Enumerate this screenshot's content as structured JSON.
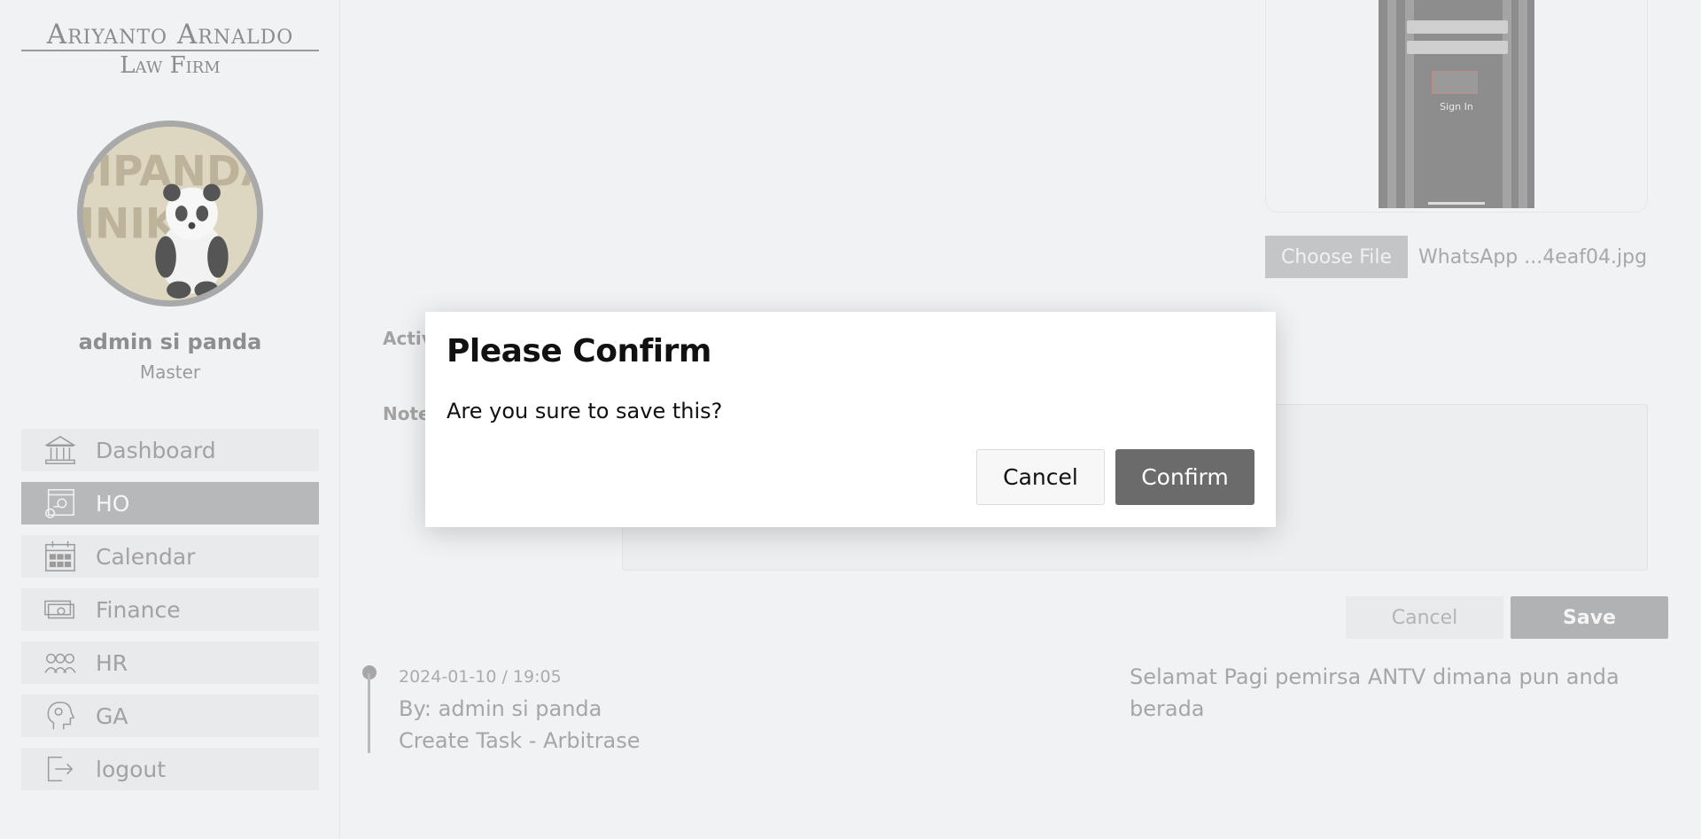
{
  "brand": {
    "name": "Ariyanto Arnaldo",
    "subtitle": "Law Firm"
  },
  "avatar": {
    "text_line1": "SIPANDA",
    "text_line2": "INIK"
  },
  "user": {
    "name": "admin si panda",
    "role": "Master"
  },
  "sidebar": {
    "items": [
      {
        "label": "Dashboard",
        "icon": "bank-icon",
        "active": false
      },
      {
        "label": "HO",
        "icon": "office-gear-icon",
        "active": true
      },
      {
        "label": "Calendar",
        "icon": "calendar-icon",
        "active": false
      },
      {
        "label": "Finance",
        "icon": "money-icon",
        "active": false
      },
      {
        "label": "HR",
        "icon": "people-icon",
        "active": false
      },
      {
        "label": "GA",
        "icon": "head-gear-icon",
        "active": false
      },
      {
        "label": "logout",
        "icon": "logout-icon",
        "active": false
      }
    ]
  },
  "preview": {
    "signin_label": "Sign In"
  },
  "file_input": {
    "button_label": "Choose File",
    "file_name": "WhatsApp ...4eaf04.jpg"
  },
  "form": {
    "activity_label": "Activ",
    "notes_label": "Note",
    "cancel_label": "Cancel",
    "save_label": "Save"
  },
  "timeline": {
    "date": "2024-01-10 / 19:05",
    "by": "By: admin si panda",
    "task": "Create Task - Arbitrase",
    "note": "Selamat Pagi pemirsa ANTV dimana pun anda berada"
  },
  "modal": {
    "title": "Please Confirm",
    "message": "Are you sure to save this?",
    "cancel_label": "Cancel",
    "confirm_label": "Confirm"
  },
  "colors": {
    "overlay_accent": "#6b6b6b",
    "active_nav": "#b7b8ba"
  }
}
